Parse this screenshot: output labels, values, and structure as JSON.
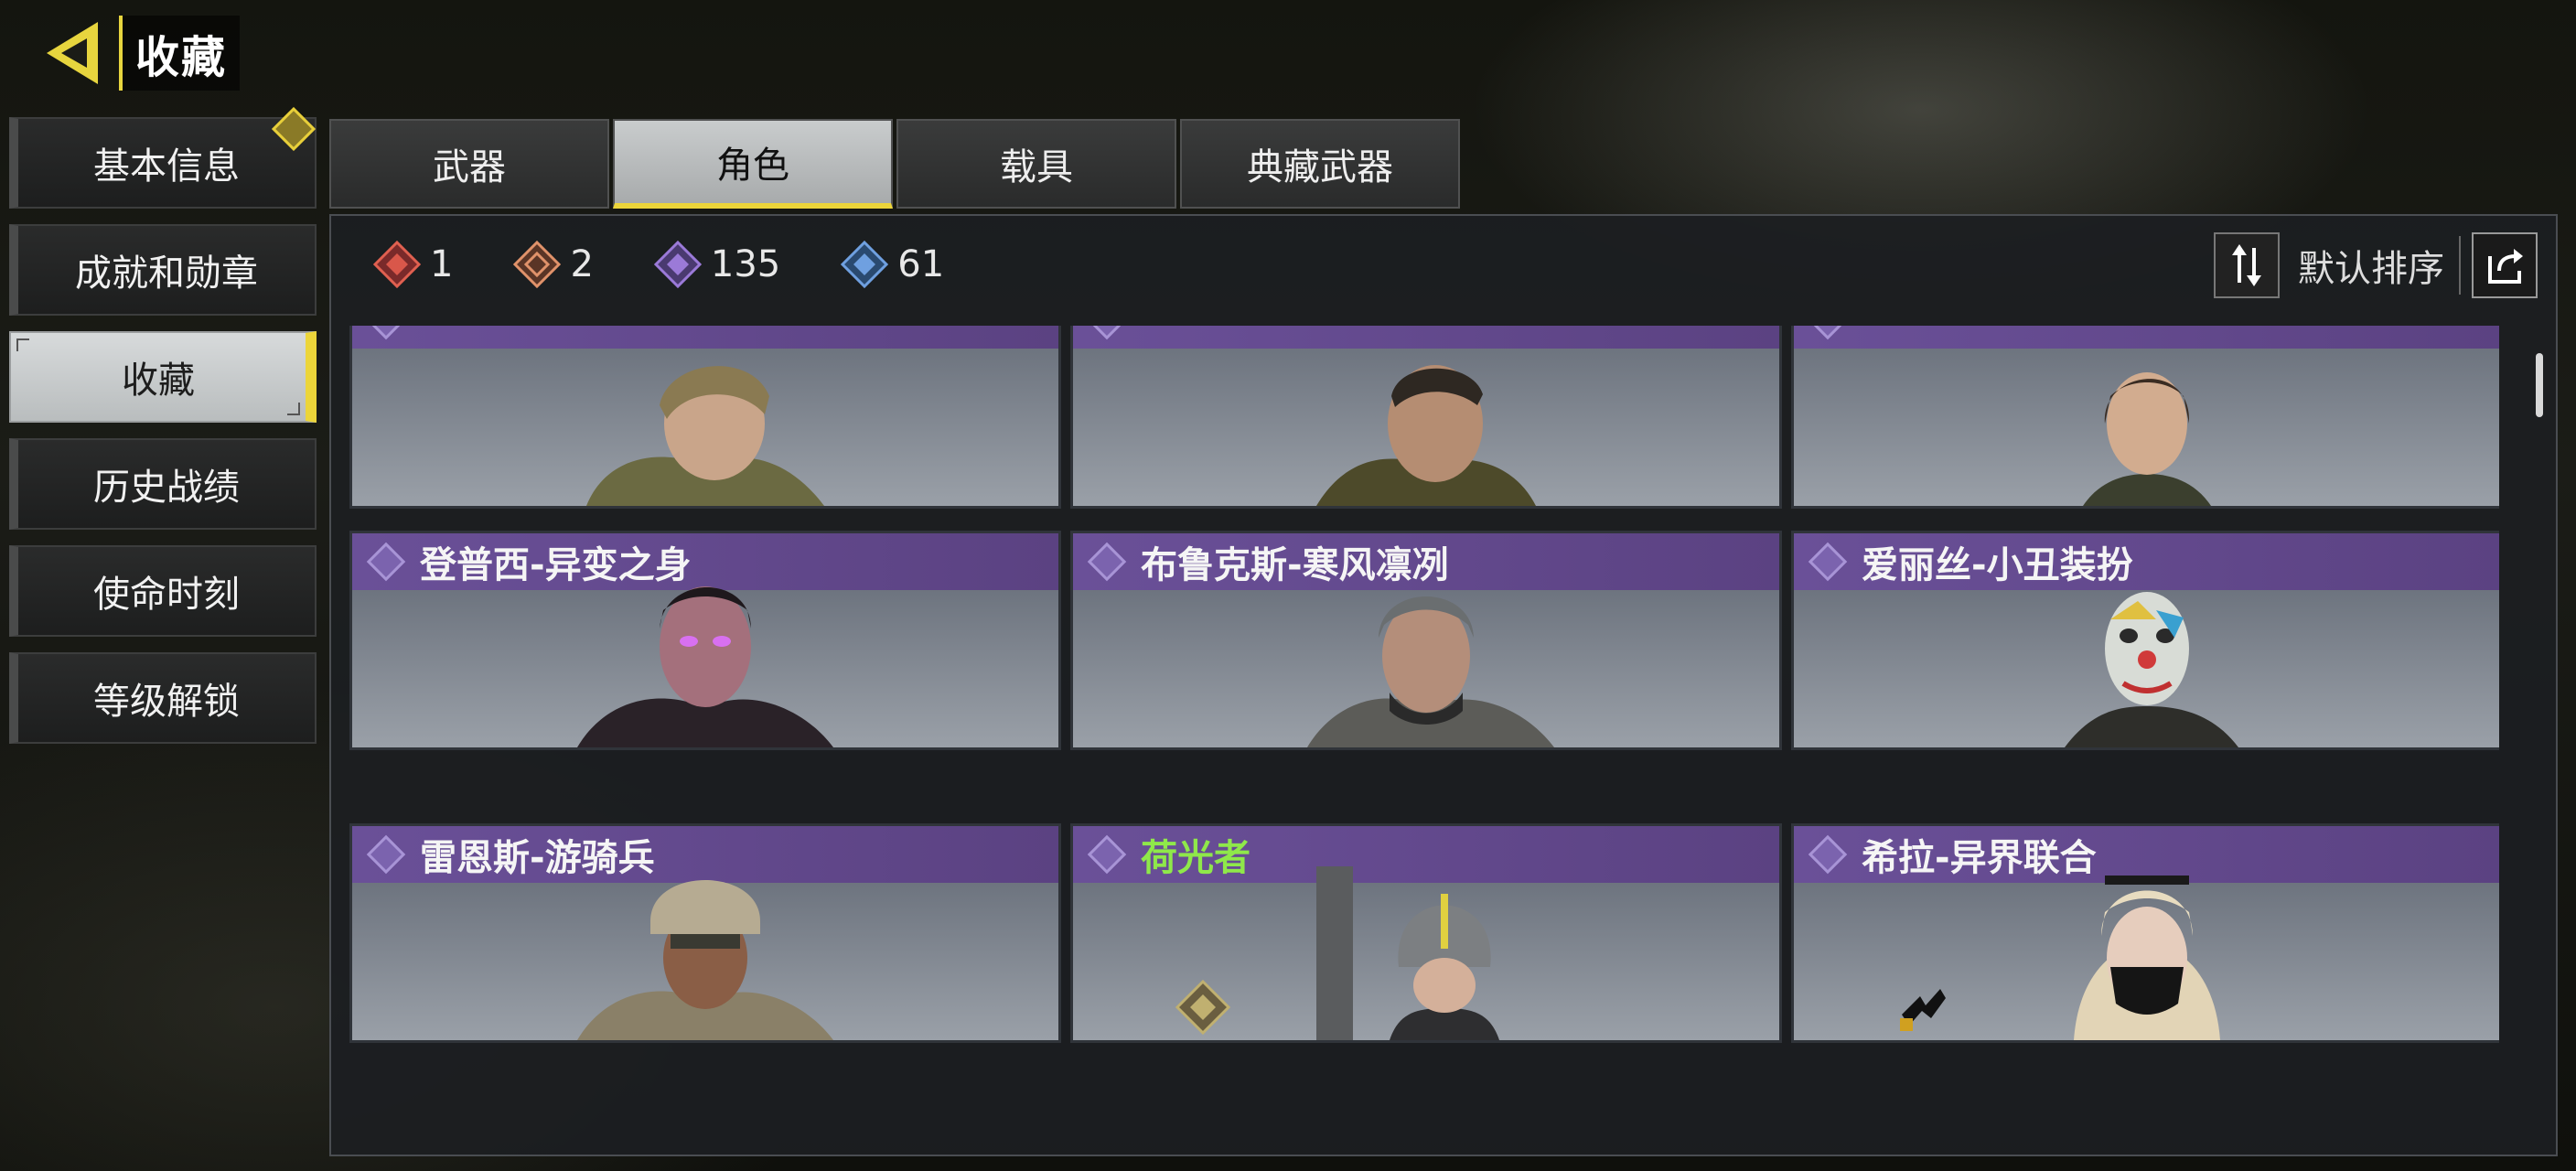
{
  "header": {
    "title": "收藏"
  },
  "sidebar": {
    "items": [
      {
        "label": "基本信息"
      },
      {
        "label": "成就和勋章"
      },
      {
        "label": "收藏"
      },
      {
        "label": "历史战绩"
      },
      {
        "label": "使命时刻"
      },
      {
        "label": "等级解锁"
      }
    ],
    "active_index": 2
  },
  "tabs": [
    {
      "label": "武器"
    },
    {
      "label": "角色"
    },
    {
      "label": "载具"
    },
    {
      "label": "典藏武器"
    }
  ],
  "stats": [
    {
      "icon": "mythic-gem-icon",
      "color": "#d9574a",
      "value": "1"
    },
    {
      "icon": "legendary-gem-icon",
      "color": "#e0926a",
      "value": "2"
    },
    {
      "icon": "epic-gem-icon",
      "color": "#9b7ad8",
      "value": "135"
    },
    {
      "icon": "rare-gem-icon",
      "color": "#6fa0e0",
      "value": "61"
    }
  ],
  "sort": {
    "label": "默认排序"
  },
  "cards": [
    {
      "title": ""
    },
    {
      "title": ""
    },
    {
      "title": ""
    },
    {
      "title": "登普西-异变之身"
    },
    {
      "title": "布鲁克斯-寒风凛冽"
    },
    {
      "title": "爱丽丝-小丑装扮"
    },
    {
      "title": "雷恩斯-游骑兵"
    },
    {
      "title": "荷光者"
    },
    {
      "title": "希拉-异界联合"
    }
  ],
  "colors": {
    "accent": "#ecd53a",
    "card_title_bg": "#6a5098",
    "highlight_name": "#8fe84a"
  }
}
